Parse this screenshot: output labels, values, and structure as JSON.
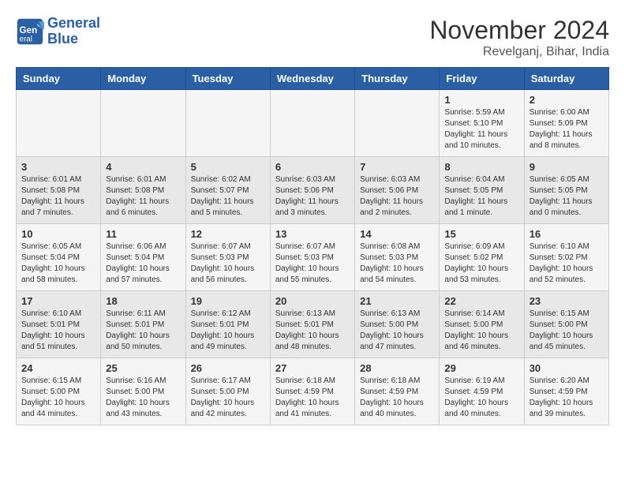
{
  "logo": {
    "line1": "General",
    "line2": "Blue"
  },
  "title": "November 2024",
  "location": "Revelganj, Bihar, India",
  "days_of_week": [
    "Sunday",
    "Monday",
    "Tuesday",
    "Wednesday",
    "Thursday",
    "Friday",
    "Saturday"
  ],
  "weeks": [
    [
      {
        "day": "",
        "info": ""
      },
      {
        "day": "",
        "info": ""
      },
      {
        "day": "",
        "info": ""
      },
      {
        "day": "",
        "info": ""
      },
      {
        "day": "",
        "info": ""
      },
      {
        "day": "1",
        "info": "Sunrise: 5:59 AM\nSunset: 5:10 PM\nDaylight: 11 hours and 10 minutes."
      },
      {
        "day": "2",
        "info": "Sunrise: 6:00 AM\nSunset: 5:09 PM\nDaylight: 11 hours and 8 minutes."
      }
    ],
    [
      {
        "day": "3",
        "info": "Sunrise: 6:01 AM\nSunset: 5:08 PM\nDaylight: 11 hours and 7 minutes."
      },
      {
        "day": "4",
        "info": "Sunrise: 6:01 AM\nSunset: 5:08 PM\nDaylight: 11 hours and 6 minutes."
      },
      {
        "day": "5",
        "info": "Sunrise: 6:02 AM\nSunset: 5:07 PM\nDaylight: 11 hours and 5 minutes."
      },
      {
        "day": "6",
        "info": "Sunrise: 6:03 AM\nSunset: 5:06 PM\nDaylight: 11 hours and 3 minutes."
      },
      {
        "day": "7",
        "info": "Sunrise: 6:03 AM\nSunset: 5:06 PM\nDaylight: 11 hours and 2 minutes."
      },
      {
        "day": "8",
        "info": "Sunrise: 6:04 AM\nSunset: 5:05 PM\nDaylight: 11 hours and 1 minute."
      },
      {
        "day": "9",
        "info": "Sunrise: 6:05 AM\nSunset: 5:05 PM\nDaylight: 11 hours and 0 minutes."
      }
    ],
    [
      {
        "day": "10",
        "info": "Sunrise: 6:05 AM\nSunset: 5:04 PM\nDaylight: 10 hours and 58 minutes."
      },
      {
        "day": "11",
        "info": "Sunrise: 6:06 AM\nSunset: 5:04 PM\nDaylight: 10 hours and 57 minutes."
      },
      {
        "day": "12",
        "info": "Sunrise: 6:07 AM\nSunset: 5:03 PM\nDaylight: 10 hours and 56 minutes."
      },
      {
        "day": "13",
        "info": "Sunrise: 6:07 AM\nSunset: 5:03 PM\nDaylight: 10 hours and 55 minutes."
      },
      {
        "day": "14",
        "info": "Sunrise: 6:08 AM\nSunset: 5:03 PM\nDaylight: 10 hours and 54 minutes."
      },
      {
        "day": "15",
        "info": "Sunrise: 6:09 AM\nSunset: 5:02 PM\nDaylight: 10 hours and 53 minutes."
      },
      {
        "day": "16",
        "info": "Sunrise: 6:10 AM\nSunset: 5:02 PM\nDaylight: 10 hours and 52 minutes."
      }
    ],
    [
      {
        "day": "17",
        "info": "Sunrise: 6:10 AM\nSunset: 5:01 PM\nDaylight: 10 hours and 51 minutes."
      },
      {
        "day": "18",
        "info": "Sunrise: 6:11 AM\nSunset: 5:01 PM\nDaylight: 10 hours and 50 minutes."
      },
      {
        "day": "19",
        "info": "Sunrise: 6:12 AM\nSunset: 5:01 PM\nDaylight: 10 hours and 49 minutes."
      },
      {
        "day": "20",
        "info": "Sunrise: 6:13 AM\nSunset: 5:01 PM\nDaylight: 10 hours and 48 minutes."
      },
      {
        "day": "21",
        "info": "Sunrise: 6:13 AM\nSunset: 5:00 PM\nDaylight: 10 hours and 47 minutes."
      },
      {
        "day": "22",
        "info": "Sunrise: 6:14 AM\nSunset: 5:00 PM\nDaylight: 10 hours and 46 minutes."
      },
      {
        "day": "23",
        "info": "Sunrise: 6:15 AM\nSunset: 5:00 PM\nDaylight: 10 hours and 45 minutes."
      }
    ],
    [
      {
        "day": "24",
        "info": "Sunrise: 6:15 AM\nSunset: 5:00 PM\nDaylight: 10 hours and 44 minutes."
      },
      {
        "day": "25",
        "info": "Sunrise: 6:16 AM\nSunset: 5:00 PM\nDaylight: 10 hours and 43 minutes."
      },
      {
        "day": "26",
        "info": "Sunrise: 6:17 AM\nSunset: 5:00 PM\nDaylight: 10 hours and 42 minutes."
      },
      {
        "day": "27",
        "info": "Sunrise: 6:18 AM\nSunset: 4:59 PM\nDaylight: 10 hours and 41 minutes."
      },
      {
        "day": "28",
        "info": "Sunrise: 6:18 AM\nSunset: 4:59 PM\nDaylight: 10 hours and 40 minutes."
      },
      {
        "day": "29",
        "info": "Sunrise: 6:19 AM\nSunset: 4:59 PM\nDaylight: 10 hours and 40 minutes."
      },
      {
        "day": "30",
        "info": "Sunrise: 6:20 AM\nSunset: 4:59 PM\nDaylight: 10 hours and 39 minutes."
      }
    ]
  ]
}
